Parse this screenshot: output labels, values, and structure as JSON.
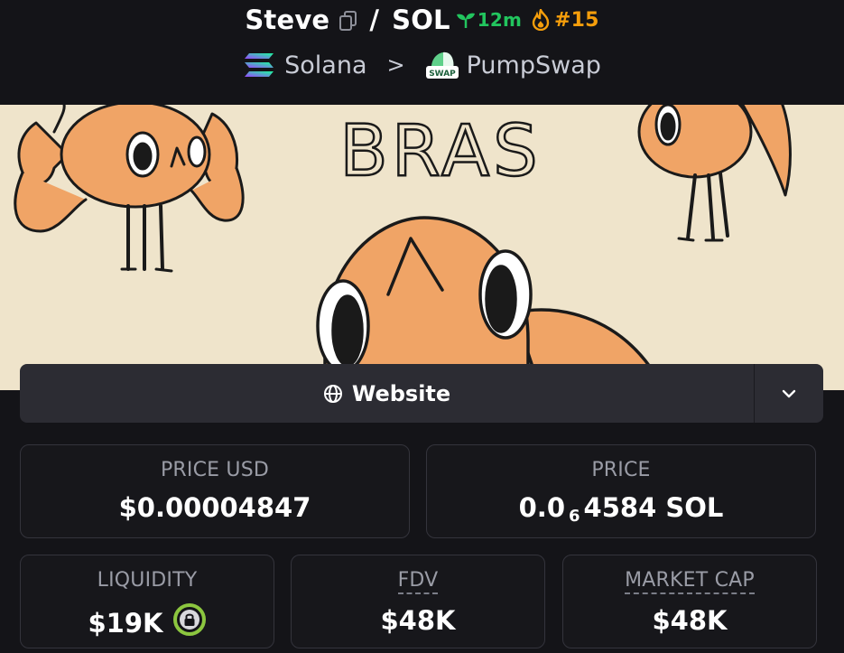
{
  "header": {
    "token_name": "Steve",
    "slash": "/",
    "quote_symbol": "SOL",
    "age": "12m",
    "rank": "#15",
    "chain": "Solana",
    "separator": ">",
    "dex": "PumpSwap",
    "dex_badge": "SWAP"
  },
  "banner": {
    "text": "BRAS"
  },
  "website_button": {
    "label": "Website"
  },
  "stats": {
    "price_usd": {
      "label": "PRICE USD",
      "value": "$0.00004847"
    },
    "price": {
      "label": "PRICE",
      "prefix": "0.0",
      "zeros": "6",
      "suffix": "4584 SOL"
    },
    "liquidity": {
      "label": "LIQUIDITY",
      "value": "$19K"
    },
    "fdv": {
      "label": "FDV",
      "value": "$48K"
    },
    "market_cap": {
      "label": "MARKET CAP",
      "value": "$48K"
    }
  },
  "colors": {
    "background": "#141418",
    "age_green": "#22c55e",
    "rank_orange": "#f59e0b",
    "fish_orange": "#f0a466",
    "banner_bg": "#efe4cb",
    "lock_green": "#8cc63f"
  }
}
